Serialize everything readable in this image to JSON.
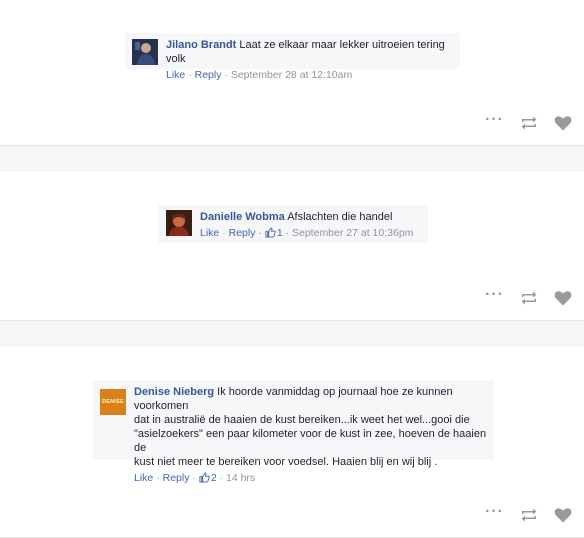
{
  "posts": [
    {
      "comment": {
        "author": "Jilano Brandt",
        "text": "Laat ze elkaar maar lekker uitroeien tering volk",
        "like_label": "Like",
        "reply_label": "Reply",
        "timestamp": "September 28 at 12:10am",
        "like_count": ""
      }
    },
    {
      "comment": {
        "author": "Danielle Wobma",
        "text": "Afslachten die handel",
        "like_label": "Like",
        "reply_label": "Reply",
        "timestamp": "September 27 at 10:36pm",
        "like_count": "1"
      }
    },
    {
      "comment": {
        "author": "Denise Nieberg",
        "text_lines": [
          "Ik hoorde vanmiddag op journaal hoe ze kunnen voorkomen",
          "dat in australië de haaien de kust bereiken...ik weet het wel...gooi die",
          "\"asielzoekers\" een paar kilometer voor de kust in zee, hoeven de haaien de",
          "kust niet meer te bereiken voor voedsel. Haaien blij en wij blij ."
        ],
        "avatar_text": "DENISE",
        "like_label": "Like",
        "reply_label": "Reply",
        "timestamp": "14 hrs",
        "like_count": "2"
      }
    }
  ],
  "icons": [
    "more-icon",
    "retweet-icon",
    "heart-icon",
    "thumbs-up-icon"
  ],
  "colors": {
    "author": "#365899",
    "link": "#4267b2",
    "meta": "#90949c",
    "comment_bg": "#f6f7f9",
    "icon": "#9a9a9a",
    "denise_avatar": "#d9801a"
  }
}
